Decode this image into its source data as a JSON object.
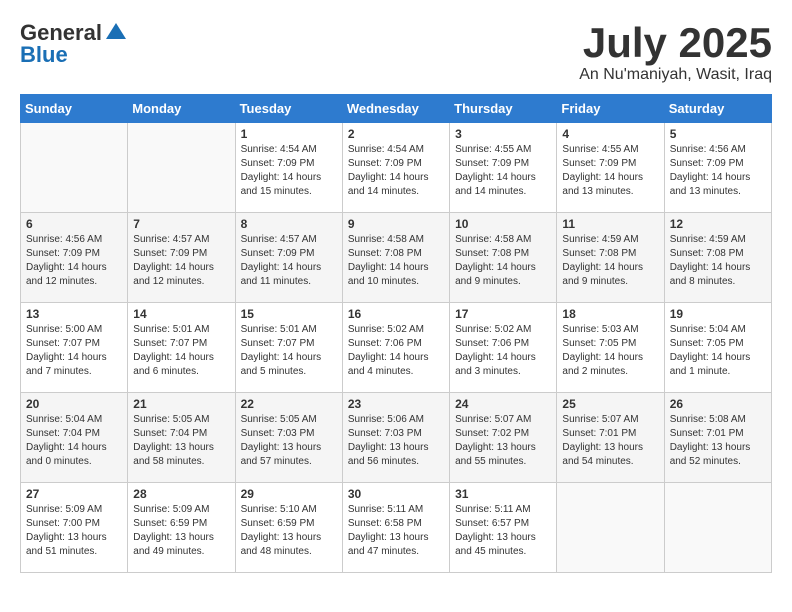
{
  "header": {
    "logo_general": "General",
    "logo_blue": "Blue",
    "month": "July 2025",
    "location": "An Nu'maniyah, Wasit, Iraq"
  },
  "weekdays": [
    "Sunday",
    "Monday",
    "Tuesday",
    "Wednesday",
    "Thursday",
    "Friday",
    "Saturday"
  ],
  "weeks": [
    [
      {
        "day": "",
        "info": ""
      },
      {
        "day": "",
        "info": ""
      },
      {
        "day": "1",
        "info": "Sunrise: 4:54 AM\nSunset: 7:09 PM\nDaylight: 14 hours and 15 minutes."
      },
      {
        "day": "2",
        "info": "Sunrise: 4:54 AM\nSunset: 7:09 PM\nDaylight: 14 hours and 14 minutes."
      },
      {
        "day": "3",
        "info": "Sunrise: 4:55 AM\nSunset: 7:09 PM\nDaylight: 14 hours and 14 minutes."
      },
      {
        "day": "4",
        "info": "Sunrise: 4:55 AM\nSunset: 7:09 PM\nDaylight: 14 hours and 13 minutes."
      },
      {
        "day": "5",
        "info": "Sunrise: 4:56 AM\nSunset: 7:09 PM\nDaylight: 14 hours and 13 minutes."
      }
    ],
    [
      {
        "day": "6",
        "info": "Sunrise: 4:56 AM\nSunset: 7:09 PM\nDaylight: 14 hours and 12 minutes."
      },
      {
        "day": "7",
        "info": "Sunrise: 4:57 AM\nSunset: 7:09 PM\nDaylight: 14 hours and 12 minutes."
      },
      {
        "day": "8",
        "info": "Sunrise: 4:57 AM\nSunset: 7:09 PM\nDaylight: 14 hours and 11 minutes."
      },
      {
        "day": "9",
        "info": "Sunrise: 4:58 AM\nSunset: 7:08 PM\nDaylight: 14 hours and 10 minutes."
      },
      {
        "day": "10",
        "info": "Sunrise: 4:58 AM\nSunset: 7:08 PM\nDaylight: 14 hours and 9 minutes."
      },
      {
        "day": "11",
        "info": "Sunrise: 4:59 AM\nSunset: 7:08 PM\nDaylight: 14 hours and 9 minutes."
      },
      {
        "day": "12",
        "info": "Sunrise: 4:59 AM\nSunset: 7:08 PM\nDaylight: 14 hours and 8 minutes."
      }
    ],
    [
      {
        "day": "13",
        "info": "Sunrise: 5:00 AM\nSunset: 7:07 PM\nDaylight: 14 hours and 7 minutes."
      },
      {
        "day": "14",
        "info": "Sunrise: 5:01 AM\nSunset: 7:07 PM\nDaylight: 14 hours and 6 minutes."
      },
      {
        "day": "15",
        "info": "Sunrise: 5:01 AM\nSunset: 7:07 PM\nDaylight: 14 hours and 5 minutes."
      },
      {
        "day": "16",
        "info": "Sunrise: 5:02 AM\nSunset: 7:06 PM\nDaylight: 14 hours and 4 minutes."
      },
      {
        "day": "17",
        "info": "Sunrise: 5:02 AM\nSunset: 7:06 PM\nDaylight: 14 hours and 3 minutes."
      },
      {
        "day": "18",
        "info": "Sunrise: 5:03 AM\nSunset: 7:05 PM\nDaylight: 14 hours and 2 minutes."
      },
      {
        "day": "19",
        "info": "Sunrise: 5:04 AM\nSunset: 7:05 PM\nDaylight: 14 hours and 1 minute."
      }
    ],
    [
      {
        "day": "20",
        "info": "Sunrise: 5:04 AM\nSunset: 7:04 PM\nDaylight: 14 hours and 0 minutes."
      },
      {
        "day": "21",
        "info": "Sunrise: 5:05 AM\nSunset: 7:04 PM\nDaylight: 13 hours and 58 minutes."
      },
      {
        "day": "22",
        "info": "Sunrise: 5:05 AM\nSunset: 7:03 PM\nDaylight: 13 hours and 57 minutes."
      },
      {
        "day": "23",
        "info": "Sunrise: 5:06 AM\nSunset: 7:03 PM\nDaylight: 13 hours and 56 minutes."
      },
      {
        "day": "24",
        "info": "Sunrise: 5:07 AM\nSunset: 7:02 PM\nDaylight: 13 hours and 55 minutes."
      },
      {
        "day": "25",
        "info": "Sunrise: 5:07 AM\nSunset: 7:01 PM\nDaylight: 13 hours and 54 minutes."
      },
      {
        "day": "26",
        "info": "Sunrise: 5:08 AM\nSunset: 7:01 PM\nDaylight: 13 hours and 52 minutes."
      }
    ],
    [
      {
        "day": "27",
        "info": "Sunrise: 5:09 AM\nSunset: 7:00 PM\nDaylight: 13 hours and 51 minutes."
      },
      {
        "day": "28",
        "info": "Sunrise: 5:09 AM\nSunset: 6:59 PM\nDaylight: 13 hours and 49 minutes."
      },
      {
        "day": "29",
        "info": "Sunrise: 5:10 AM\nSunset: 6:59 PM\nDaylight: 13 hours and 48 minutes."
      },
      {
        "day": "30",
        "info": "Sunrise: 5:11 AM\nSunset: 6:58 PM\nDaylight: 13 hours and 47 minutes."
      },
      {
        "day": "31",
        "info": "Sunrise: 5:11 AM\nSunset: 6:57 PM\nDaylight: 13 hours and 45 minutes."
      },
      {
        "day": "",
        "info": ""
      },
      {
        "day": "",
        "info": ""
      }
    ]
  ]
}
